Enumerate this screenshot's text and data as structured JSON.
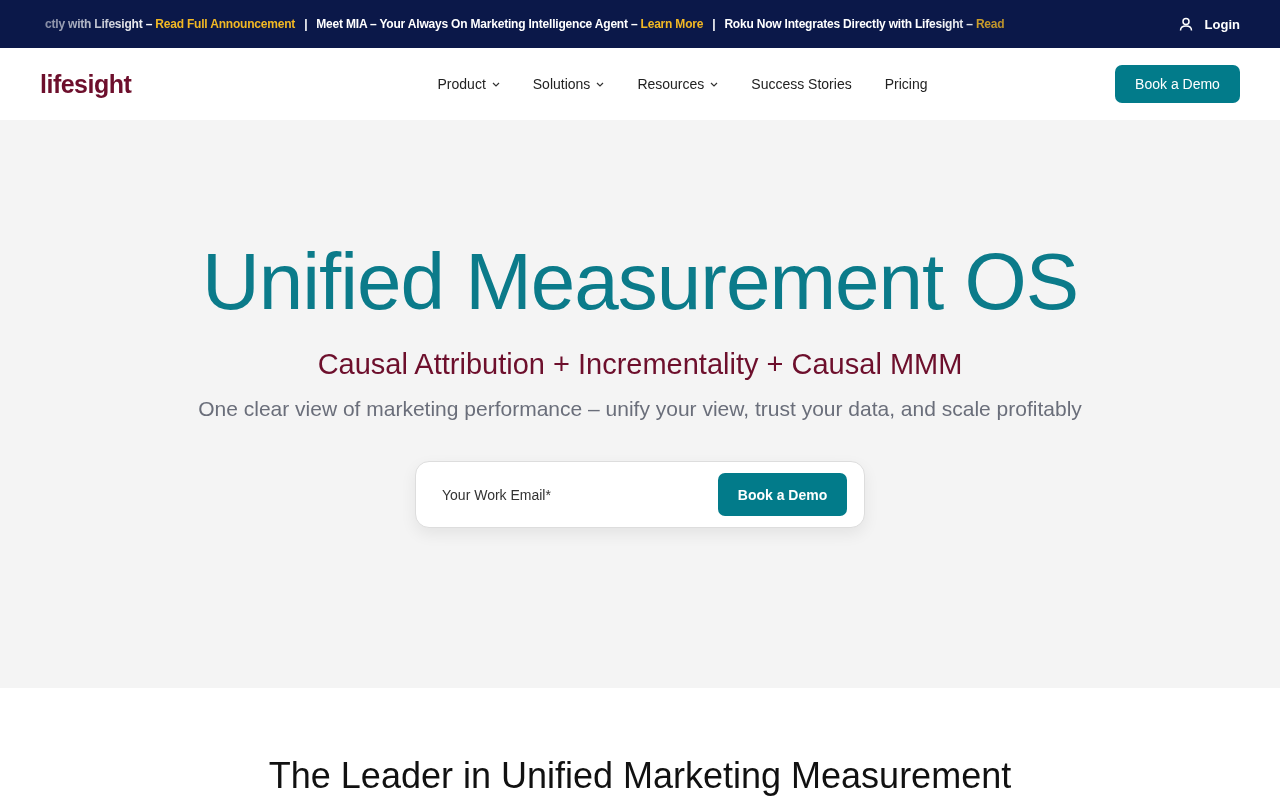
{
  "ticker": [
    {
      "text": "ctly with Lifesight – ",
      "link": "Read Full Announcement"
    },
    {
      "text": "Meet MIA – Your Always On Marketing Intelligence Agent – ",
      "link": "Learn More"
    },
    {
      "text": "Roku Now Integrates Directly with Lifesight – ",
      "link": "Read"
    }
  ],
  "ticker_separator": "|",
  "login": "Login",
  "logo": "lifesight",
  "nav": [
    {
      "label": "Product",
      "dropdown": true
    },
    {
      "label": "Solutions",
      "dropdown": true
    },
    {
      "label": "Resources",
      "dropdown": true
    },
    {
      "label": "Success Stories",
      "dropdown": false
    },
    {
      "label": "Pricing",
      "dropdown": false
    }
  ],
  "header_button": "Book a Demo",
  "hero": {
    "title": "Unified Measurement OS",
    "subtitle": "Causal Attribution + Incrementality + Causal MMM",
    "description": "One clear view of marketing performance – unify your view, trust your data, and scale profitably",
    "email_placeholder": "Your Work Email*",
    "button": "Book a Demo"
  },
  "next_heading": "The Leader in Unified Marketing Measurement"
}
